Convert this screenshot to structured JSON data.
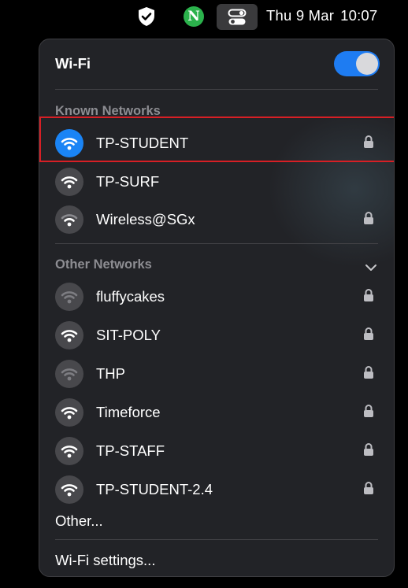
{
  "menubar": {
    "icons": [
      "shield-check-icon",
      "n-badge-icon",
      "control-center-icon"
    ],
    "n_badge_letter": "N",
    "date": "Thu 9 Mar",
    "time": "10:07"
  },
  "wifi": {
    "title": "Wi-Fi",
    "enabled": true,
    "known_label": "Known Networks",
    "known_networks": [
      {
        "name": "TP-STUDENT",
        "locked": true,
        "connected": true,
        "signal": "strong"
      },
      {
        "name": "TP-SURF",
        "locked": false,
        "connected": false,
        "signal": "strong"
      },
      {
        "name": "Wireless@SGx",
        "locked": true,
        "connected": false,
        "signal": "medium"
      }
    ],
    "other_label": "Other Networks",
    "other_networks": [
      {
        "name": "fluffycakes",
        "locked": true,
        "signal": "weak"
      },
      {
        "name": "SIT-POLY",
        "locked": true,
        "signal": "strong"
      },
      {
        "name": "THP",
        "locked": true,
        "signal": "weak"
      },
      {
        "name": "Timeforce",
        "locked": true,
        "signal": "strong"
      },
      {
        "name": "TP-STAFF",
        "locked": true,
        "signal": "strong"
      },
      {
        "name": "TP-STUDENT-2.4",
        "locked": true,
        "signal": "strong"
      }
    ],
    "other_item": "Other...",
    "settings_label": "Wi-Fi settings..."
  },
  "colors": {
    "accent": "#1a84f5",
    "highlight_border": "#d71f25",
    "panel_bg": "#222327"
  }
}
